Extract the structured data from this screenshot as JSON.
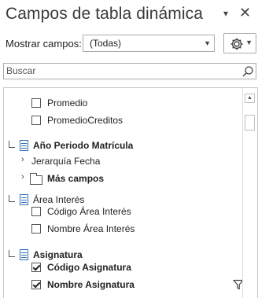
{
  "panel": {
    "title": "Campos de tabla dinámica",
    "show_fields_label": "Mostrar campos:",
    "show_fields_value": "(Todas)",
    "search_placeholder": "Buscar"
  },
  "fields": {
    "promedio": "Promedio",
    "promedio_creditos": "PromedioCreditos",
    "anio_periodo": "Año Periodo Matrícula",
    "jerarquia_fecha": "Jerarquía Fecha",
    "mas_campos": "Más campos",
    "area_interes": "Área Interés",
    "codigo_area": "Código Área Interés",
    "nombre_area": "Nombre Área Interés",
    "asignatura": "Asignatura",
    "codigo_asignatura": "Código Asignatura",
    "nombre_asignatura": "Nombre Asignatura"
  },
  "states": {
    "promedio_checked": false,
    "promedio_creditos_checked": false,
    "codigo_area_checked": false,
    "nombre_area_checked": false,
    "codigo_asignatura_checked": true,
    "nombre_asignatura_checked": true
  },
  "colors": {
    "table_icon": "#2e6fb5",
    "border": "#ababab"
  },
  "icons": [
    "dropdown-arrow-icon",
    "close-icon",
    "gear-icon",
    "search-icon",
    "table-icon",
    "folder-icon",
    "filter-icon",
    "chevron-right-icon"
  ]
}
